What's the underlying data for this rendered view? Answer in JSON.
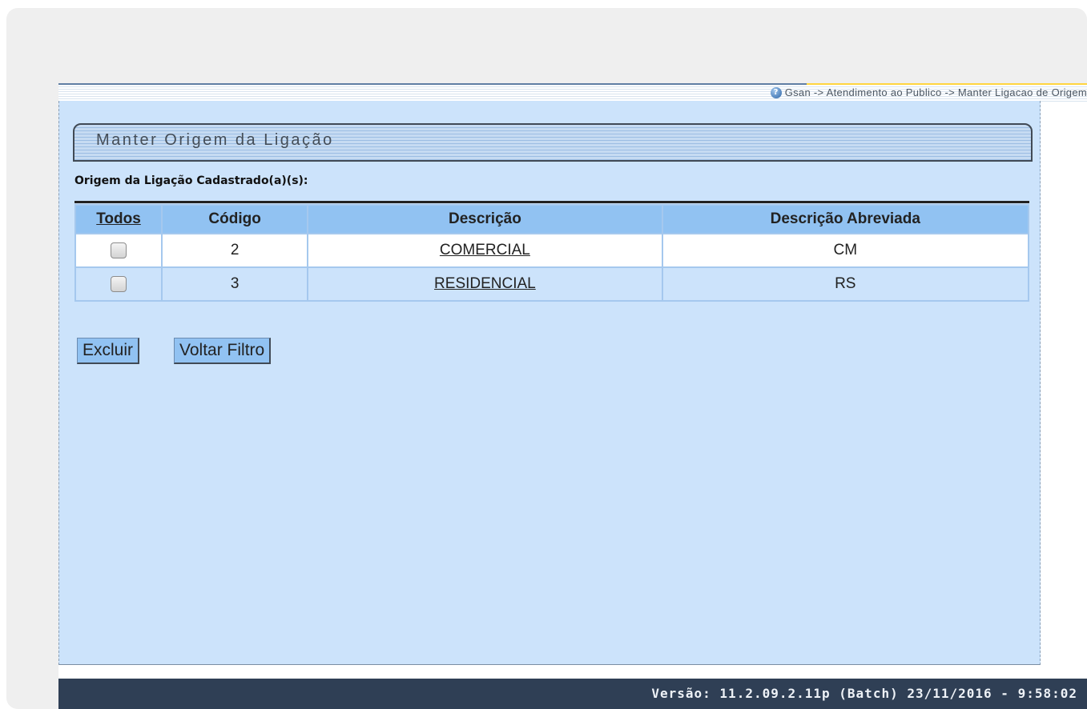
{
  "breadcrumb": "Gsan -> Atendimento ao Publico -> Manter Ligacao de Origem",
  "page_title": "Manter Origem da Ligação",
  "subtitle": "Origem da Ligação Cadastrado(a)(s):",
  "table": {
    "headers": {
      "todos": "Todos",
      "codigo": "Código",
      "descricao": "Descrição",
      "descricao_abreviada": "Descrição Abreviada"
    },
    "rows": [
      {
        "codigo": "2",
        "descricao": "COMERCIAL",
        "abreviada": "CM",
        "checked": false
      },
      {
        "codigo": "3",
        "descricao": "RESIDENCIAL",
        "abreviada": "RS",
        "checked": false
      }
    ]
  },
  "buttons": {
    "excluir": "Excluir",
    "voltar_filtro": "Voltar Filtro"
  },
  "footer": "Versão: 11.2.09.2.11p (Batch) 23/11/2016 - 9:58:02",
  "icons": {
    "help": "help-icon"
  }
}
